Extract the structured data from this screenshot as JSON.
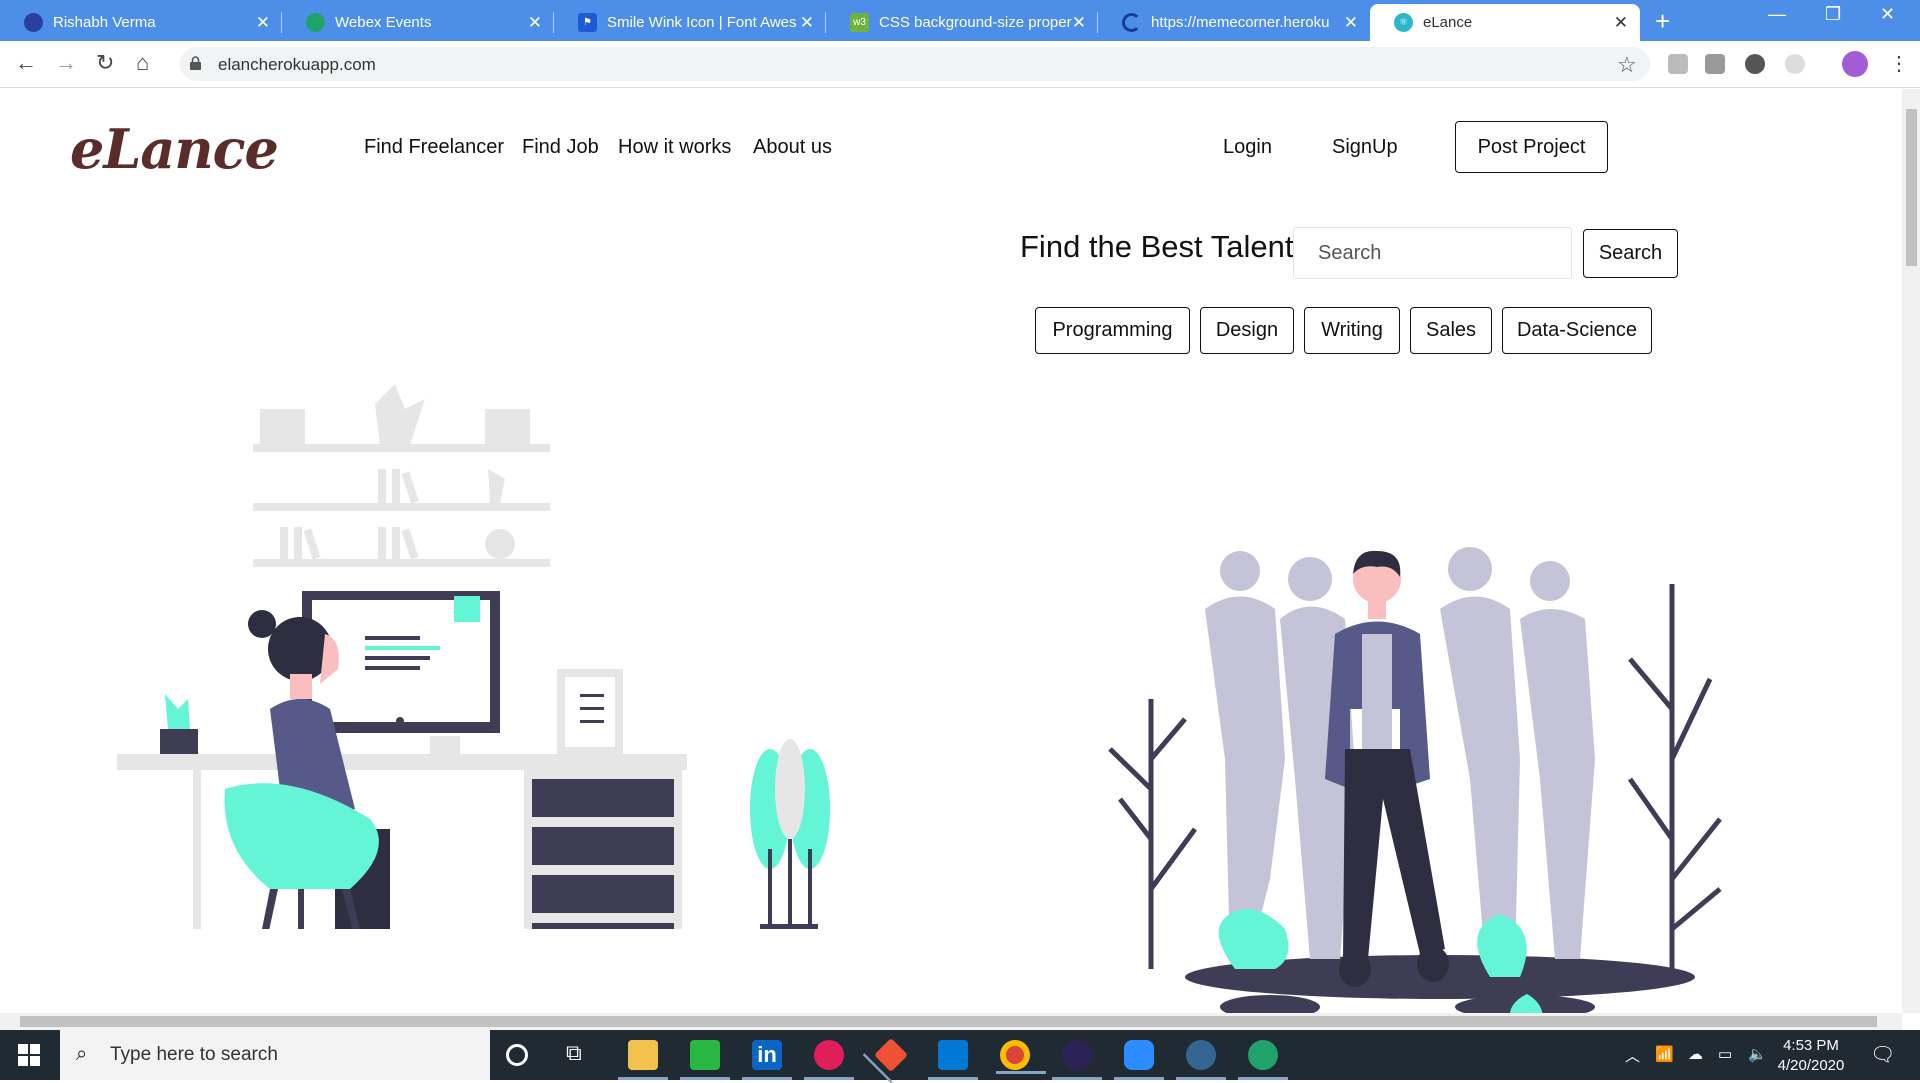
{
  "browser": {
    "tabs": [
      {
        "title": "Rishabh Verma",
        "favicon_color": "#2a3f9e"
      },
      {
        "title": "Webex Events",
        "favicon_color": "#20a36b"
      },
      {
        "title": "Smile Wink Icon | Font Awes",
        "favicon_color": "#1e5ad6"
      },
      {
        "title": "CSS background-size proper",
        "favicon_color": "#6fb33f"
      },
      {
        "title": "https://memecorner.heroku",
        "favicon_color": "#1a3aa0"
      },
      {
        "title": "eLance",
        "favicon_color": "#2bb7c9"
      }
    ],
    "active_tab": 5,
    "url": "elancherokuapp.com"
  },
  "site": {
    "logo": "eLance",
    "nav": {
      "find_freelancer": "Find Freelancer",
      "find_job": "Find Job",
      "how_it_works": "How it works",
      "about_us": "About us",
      "login": "Login",
      "signup": "SignUp",
      "post_project": "Post Project"
    },
    "hero": {
      "heading": "Find the Best Talent",
      "search_placeholder": "Search",
      "search_button": "Search",
      "categories": [
        "Programming",
        "Design",
        "Writing",
        "Sales",
        "Data-Science"
      ]
    },
    "colors": {
      "accent": "#64f4d6",
      "dark": "#3f3d56",
      "purple": "#575a89",
      "ghost": "#c5c3d8"
    }
  },
  "taskbar": {
    "search_placeholder": "Type here to search",
    "time": "4:53 PM",
    "date": "4/20/2020"
  }
}
